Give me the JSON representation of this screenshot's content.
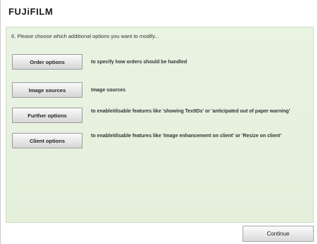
{
  "header": {
    "brand": "FUJiFILM"
  },
  "main": {
    "instruction": "6. Please choose which additional options you want to modify...",
    "options": [
      {
        "label": "Order options",
        "description": "to specify how orders should be handled"
      },
      {
        "label": "Image sources",
        "description": "Image sources"
      },
      {
        "label": "Further options",
        "description": "to enable/disable features like 'showing TextIDs' or 'anticipated out of paper warning'"
      },
      {
        "label": "Client options",
        "description": "to enable/disable features like 'Image enhancement on client' or 'Resize on client'"
      }
    ]
  },
  "footer": {
    "continue_label": "Continue"
  }
}
